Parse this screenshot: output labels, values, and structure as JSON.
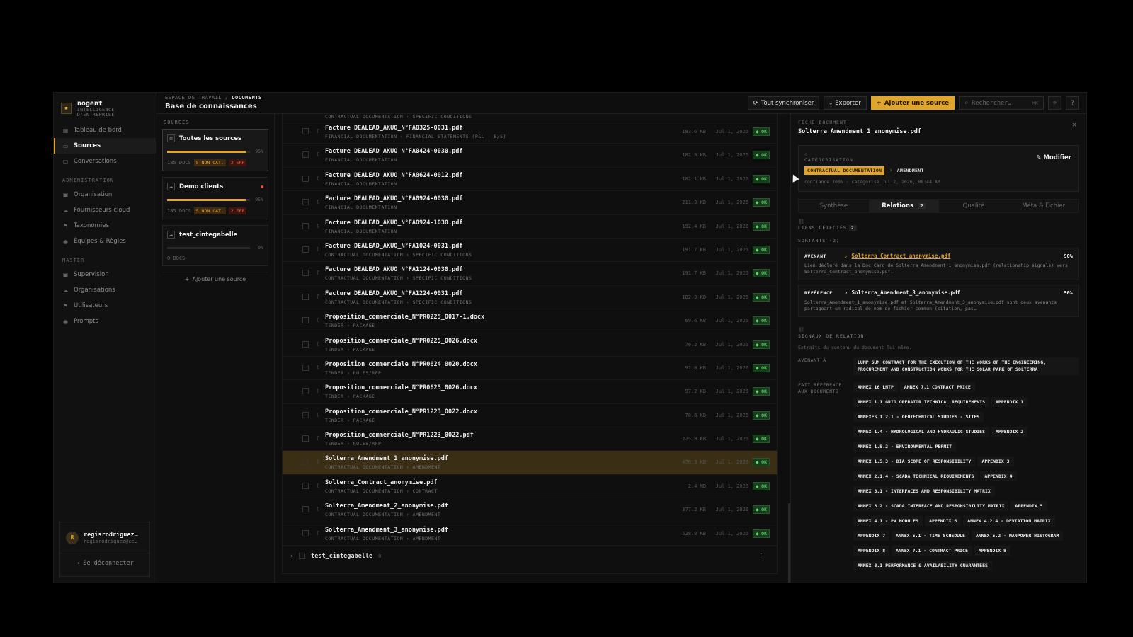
{
  "brand": {
    "name": "nogent",
    "subtitle": "INTELLIGENCE D'ENTREPRISE"
  },
  "nav": {
    "main": [
      {
        "label": "Tableau de bord",
        "icon": "grid-icon"
      },
      {
        "label": "Sources",
        "icon": "folder-icon",
        "active": true
      },
      {
        "label": "Conversations",
        "icon": "chat-icon"
      }
    ],
    "admin_title": "ADMINISTRATION",
    "admin": [
      "Organisation",
      "Fournisseurs cloud",
      "Taxonomies",
      "Équipes & Règles"
    ],
    "master_title": "MASTER",
    "master": [
      "Supervision",
      "Organisations",
      "Utilisateurs",
      "Prompts"
    ],
    "user": {
      "initial": "R",
      "name": "regisrodriguez…",
      "email": "regisrodriguez@ce…"
    },
    "logout": "Se déconnecter"
  },
  "header": {
    "crumb_root": "ESPACE DE TRAVAIL",
    "crumb_current": "DOCUMENTS",
    "title": "Base de connaissances",
    "sync": "Tout synchroniser",
    "export": "Exporter",
    "add_source": "Ajouter une source",
    "search_placeholder": "Rechercher…",
    "search_kbd": "⌘K"
  },
  "sources": {
    "label": "SOURCES",
    "items": [
      {
        "name": "Toutes les sources",
        "pct": "95%",
        "fill": 0.95,
        "docs": "185 DOCS",
        "warn": "5 NON CAT.",
        "err": "2 ERR"
      },
      {
        "name": "Demo clients",
        "pct": "95%",
        "fill": 0.95,
        "docs": "185 DOCS",
        "warn": "5 NON CAT.",
        "err": "2 ERR"
      },
      {
        "name": "test_cintegabelle",
        "pct": "0%",
        "fill": 0,
        "docs": "0 DOCS"
      }
    ],
    "add": "Ajouter une source"
  },
  "docs": {
    "first_cat": "CONTRACTUAL DOCUMENTATION › SPECIFIC CONDITIONS",
    "rows": [
      {
        "name": "Facture DEALEAD_AKUO_N°FA0325-0031.pdf",
        "cat": "FINANCIAL DOCUMENTATION › FINANCIAL STATEMENTS (P&L · B/S)",
        "size": "183.6 KB",
        "date": "Jul 1, 2026",
        "status": "● OK"
      },
      {
        "name": "Facture DEALEAD_AKUO_N°FA0424-0030.pdf",
        "cat": "FINANCIAL DOCUMENTATION",
        "size": "182.9 KB",
        "date": "Jul 1, 2026",
        "status": "● OK"
      },
      {
        "name": "Facture DEALEAD_AKUO_N°FA0624-0012.pdf",
        "cat": "FINANCIAL DOCUMENTATION",
        "size": "182.1 KB",
        "date": "Jul 1, 2026",
        "status": "● OK"
      },
      {
        "name": "Facture DEALEAD_AKUO_N°FA0924-0030.pdf",
        "cat": "FINANCIAL DOCUMENTATION",
        "size": "211.3 KB",
        "date": "Jul 1, 2026",
        "status": "● OK"
      },
      {
        "name": "Facture DEALEAD_AKUO_N°FA0924-1030.pdf",
        "cat": "FINANCIAL DOCUMENTATION",
        "size": "192.4 KB",
        "date": "Jul 1, 2026",
        "status": "● OK"
      },
      {
        "name": "Facture DEALEAD_AKUO_N°FA1024-0031.pdf",
        "cat": "CONTRACTUAL DOCUMENTATION › SPECIFIC CONDITIONS",
        "size": "191.7 KB",
        "date": "Jul 1, 2026",
        "status": "● OK"
      },
      {
        "name": "Facture DEALEAD_AKUO_N°FA1124-0030.pdf",
        "cat": "CONTRACTUAL DOCUMENTATION › SPECIFIC CONDITIONS",
        "size": "191.7 KB",
        "date": "Jul 1, 2026",
        "status": "● OK"
      },
      {
        "name": "Facture DEALEAD_AKUO_N°FA1224-0031.pdf",
        "cat": "CONTRACTUAL DOCUMENTATION › SPECIFIC CONDITIONS",
        "size": "182.3 KB",
        "date": "Jul 1, 2026",
        "status": "● OK"
      },
      {
        "name": "Proposition_commerciale_N°PR0225_0017-1.docx",
        "cat": "TENDER › PACKAGE",
        "size": "69.6 KB",
        "date": "Jul 1, 2026",
        "status": "● OK"
      },
      {
        "name": "Proposition_commerciale_N°PR0225_0026.docx",
        "cat": "TENDER › PACKAGE",
        "size": "70.2 KB",
        "date": "Jul 1, 2026",
        "status": "● OK"
      },
      {
        "name": "Proposition_commerciale_N°PR0624_0020.docx",
        "cat": "TENDER › RULES/RFP",
        "size": "91.0 KB",
        "date": "Jul 1, 2026",
        "status": "● OK"
      },
      {
        "name": "Proposition_commerciale_N°PR0625_0026.docx",
        "cat": "TENDER › PACKAGE",
        "size": "97.2 KB",
        "date": "Jul 1, 2026",
        "status": "● OK"
      },
      {
        "name": "Proposition_commerciale_N°PR1223_0022.docx",
        "cat": "TENDER › PACKAGE",
        "size": "70.8 KB",
        "date": "Jul 1, 2026",
        "status": "● OK"
      },
      {
        "name": "Proposition_commerciale_N°PR1223_0022.pdf",
        "cat": "TENDER › RULES/RFP",
        "size": "225.9 KB",
        "date": "Jul 1, 2026",
        "status": "● OK"
      },
      {
        "name": "Solterra_Amendment_1_anonymise.pdf",
        "cat": "CONTRACTUAL DOCUMENTATION › AMENDMENT",
        "size": "476.3 KB",
        "date": "Jul 1, 2026",
        "status": "● OK",
        "selected": true
      },
      {
        "name": "Solterra_Contract_anonymise.pdf",
        "cat": "CONTRACTUAL DOCUMENTATION › CONTRACT",
        "size": "2.4 MB",
        "date": "Jul 1, 2026",
        "status": "● OK"
      },
      {
        "name": "Solterra_Amendment_2_anonymise.pdf",
        "cat": "CONTRACTUAL DOCUMENTATION › AMENDMENT",
        "size": "377.2 KB",
        "date": "Jul 1, 2026",
        "status": "● OK"
      },
      {
        "name": "Solterra_Amendment_3_anonymise.pdf",
        "cat": "CONTRACTUAL DOCUMENTATION › AMENDMENT",
        "size": "528.8 KB",
        "date": "Jul 1, 2026",
        "status": "● OK"
      }
    ],
    "group": {
      "name": "test_cintegabelle",
      "count": "0"
    }
  },
  "detail": {
    "label": "FICHE DOCUMENT",
    "file": "Solterra_Amendment_1_anonymise.pdf",
    "cat_label": "CATÉGORISATION",
    "cat_main": "CONTRACTUAL DOCUMENTATION",
    "cat_sep": "›",
    "cat_sub": "AMENDMENT",
    "confidence": "confiance 100% · catégorisé Jul 2, 2026, 08:44 AM",
    "edit": "Modifier",
    "tabs": [
      {
        "label": "Synthèse"
      },
      {
        "label": "Relations",
        "count": "2",
        "active": true
      },
      {
        "label": "Qualité"
      },
      {
        "label": "Méta & Fichier"
      }
    ],
    "links_label": "LIENS DÉTECTÉS",
    "links_count": "2",
    "outgoing_label": "SORTANTS (2)",
    "relations": [
      {
        "type": "AVENANT",
        "arrow": "↗",
        "target": "Solterra_Contract_anonymise.pdf",
        "pct": "90%",
        "desc": "Lien déclaré dans la Doc Card de Solterra_Amendment_1_anonymise.pdf (relationship_signals) vers Solterra_Contract_anonymise.pdf."
      },
      {
        "type": "RÉFÉRENCE",
        "arrow": "↗",
        "target": "Solterra_Amendment_3_anonymise.pdf",
        "pct": "90%",
        "desc": "Solterra_Amendment_1_anonymise.pdf et Solterra_Amendment_3_anonymise.pdf sont deux avenants partageant un radical de nom de fichier commun (citation, pas…"
      }
    ],
    "signals_label": "SIGNAUX DE RELATION",
    "signals_intro": "Extraits du contenu du document lui-même.",
    "avenant_key": "AVENANT À",
    "avenant_val": "LUMP SUM CONTRACT FOR THE EXECUTION OF THE WORKS OF THE ENGINEERING, PROCUREMENT AND CONSTRUCTION WORKS FOR THE SOLAR PARK OF SOLTERRA",
    "refs_key": "FAIT RÉFÉRENCE AUX DOCUMENTS",
    "refs": [
      "ANNEX 16 LNTP",
      "ANNEX 7.1 CONTRACT PRICE",
      "ANNEX 1.1 GRID OPERATOR TECHNICAL REQUIREMENTS",
      "APPENDIX 1",
      "ANNEXES 1.2.1 - GEOTECHNICAL STUDIES - SITES",
      "ANNEX 1.4 - HYDROLOGICAL AND HYDRAULIC STUDIES",
      "APPENDIX 2",
      "ANNEX 1.5.2 - ENVIRONMENTAL PERMIT",
      "ANNEX 1.5.3 - DIA SCOPE OF RESPONSIBILITY",
      "APPENDIX 3",
      "ANNEX 2.1.4 - SCADA TECHNICAL REQUIREMENTS",
      "APPENDIX 4",
      "ANNEX 3.1 - INTERFACES AND RESPONSIBILITY MATRIX",
      "ANNEX 3.2 - SCADA INTERFACE AND RESPONSIBILITY MATRIX",
      "APPENDIX 5",
      "ANNEX 4.1 - PV MODULES",
      "APPENDIX 6",
      "ANNEX 4.2.4 - DEVIATION MATRIX",
      "APPENDIX 7",
      "ANNEX 5.1 - TIME SCHEDULE",
      "ANNEX 5.2 - MANPOWER HISTOGRAM",
      "APPENDIX 8",
      "ANNEX 7.1 - CONTRACT PRICE",
      "APPENDIX 9",
      "ANNEX 8.1 PERFORMANCE & AVAILABILITY GUARANTEES"
    ]
  },
  "colors": {
    "accent": "#e0a52c",
    "ok": "#5dd06a",
    "error": "#e05a3c",
    "selected_row": "#3a2e14"
  }
}
